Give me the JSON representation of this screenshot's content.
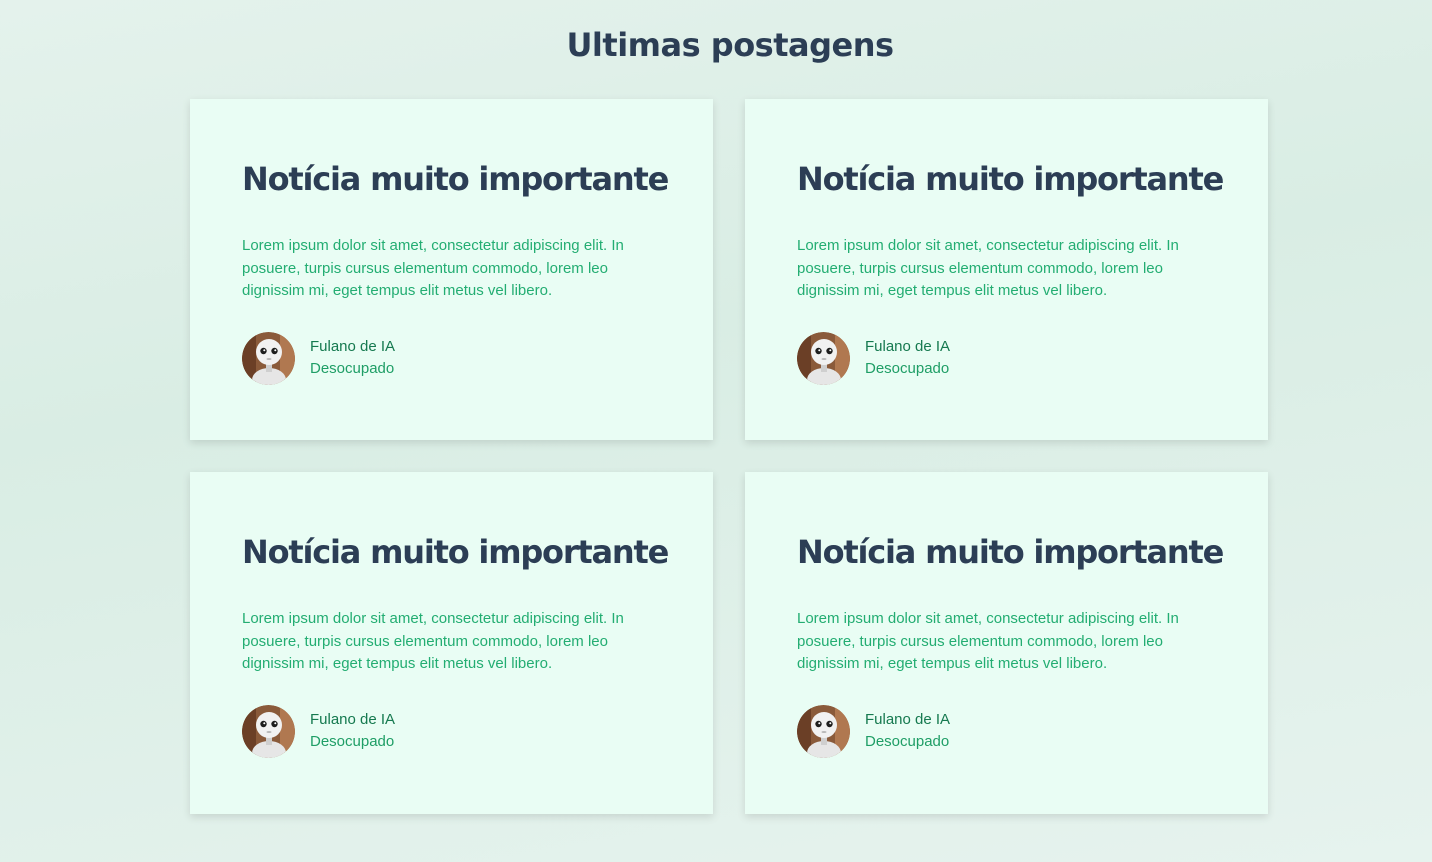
{
  "page": {
    "title": "Ultimas postagens"
  },
  "posts": [
    {
      "title": "Notícia muito importante",
      "text": "Lorem ipsum dolor sit amet, consectetur adipiscing elit. In posuere, turpis cursus elementum commodo, lorem leo dignissim mi, eget tempus elit metus vel libero.",
      "author_name": "Fulano de IA",
      "author_role": "Desocupado",
      "avatar_icon": "robot-avatar"
    },
    {
      "title": "Notícia muito importante",
      "text": "Lorem ipsum dolor sit amet, consectetur adipiscing elit. In posuere, turpis cursus elementum commodo, lorem leo dignissim mi, eget tempus elit metus vel libero.",
      "author_name": "Fulano de IA",
      "author_role": "Desocupado",
      "avatar_icon": "robot-avatar"
    },
    {
      "title": "Notícia muito importante",
      "text": "Lorem ipsum dolor sit amet, consectetur adipiscing elit. In posuere, turpis cursus elementum commodo, lorem leo dignissim mi, eget tempus elit metus vel libero.",
      "author_name": "Fulano de IA",
      "author_role": "Desocupado",
      "avatar_icon": "robot-avatar"
    },
    {
      "title": "Notícia muito importante",
      "text": "Lorem ipsum dolor sit amet, consectetur adipiscing elit. In posuere, turpis cursus elementum commodo, lorem leo dignissim mi, eget tempus elit metus vel libero.",
      "author_name": "Fulano de IA",
      "author_role": "Desocupado",
      "avatar_icon": "robot-avatar"
    }
  ],
  "colors": {
    "background": "#dceee6",
    "card_background": "#e9fdf4",
    "heading": "#2c3e55",
    "body_text": "#23ad72",
    "author_name": "#15794f",
    "author_role": "#1f9e66"
  }
}
